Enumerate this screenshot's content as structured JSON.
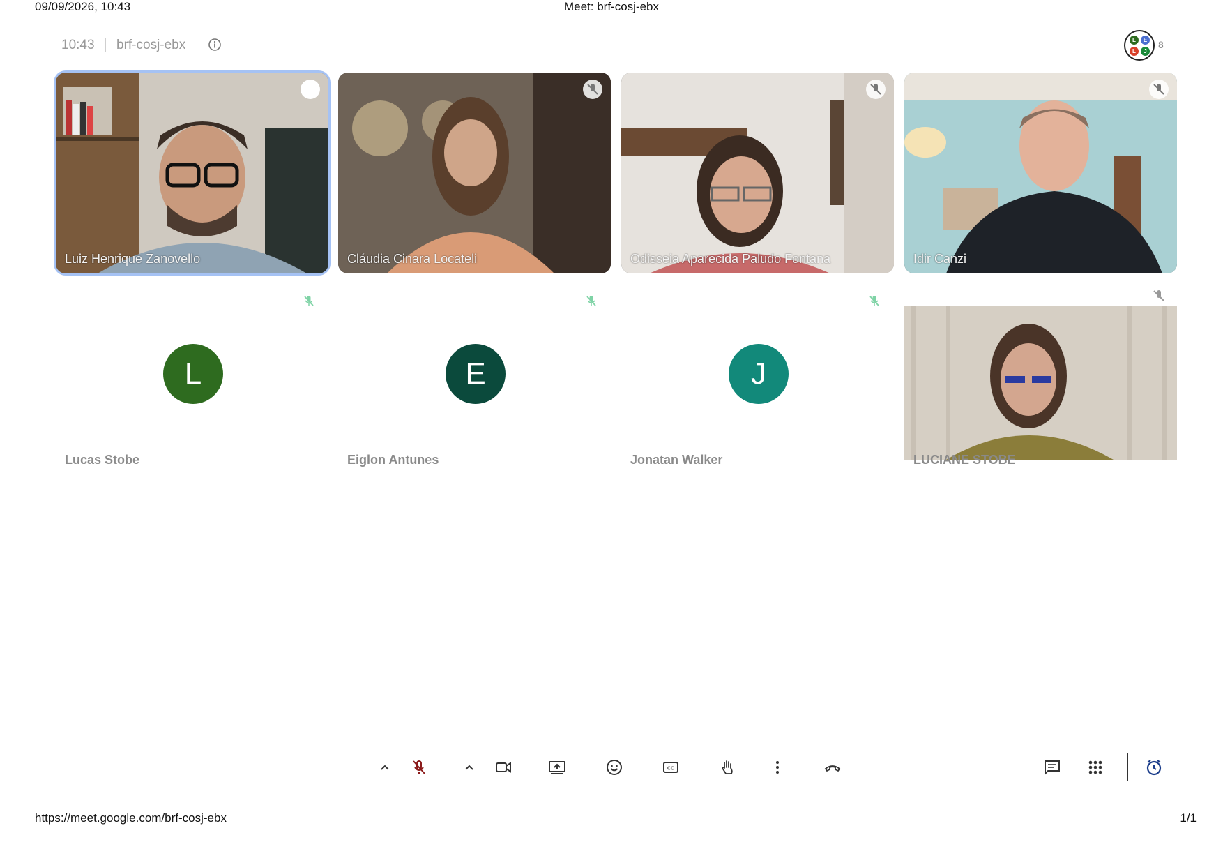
{
  "print": {
    "datetime": "09/09/2026, 10:43",
    "title": "Meet: brf-cosj-ebx",
    "url": "https://meet.google.com/brf-cosj-ebx",
    "page": "1/1"
  },
  "meeting": {
    "time": "10:43",
    "code": "brf-cosj-ebx",
    "participant_count": "8"
  },
  "people_avatars": [
    "L",
    "E",
    "L",
    "J"
  ],
  "participants": [
    {
      "name": "Luiz Henrique Zanovello",
      "type": "video",
      "active": true
    },
    {
      "name": "Cláudia Cinara Locateli",
      "type": "video"
    },
    {
      "name": "Odisseia Aparecida Paludo Fontana",
      "type": "video"
    },
    {
      "name": "Idir Canzi",
      "type": "video"
    },
    {
      "name": "Lucas Stobe",
      "type": "avatar",
      "initial": "L",
      "color": "#2e6b1f"
    },
    {
      "name": "Eiglon Antunes",
      "type": "avatar",
      "initial": "E",
      "color": "#0b4a3c"
    },
    {
      "name": "Jonatan Walker",
      "type": "avatar",
      "initial": "J",
      "color": "#12897a"
    },
    {
      "name": "LUCIANE STOBE",
      "type": "video"
    }
  ],
  "colors": {
    "mic_off_red": "#8b1a1a",
    "mic_muted_green": "#7fd3a6",
    "active_outline": "#a5c2f4"
  },
  "toolbar_icons": [
    "chevron-up-icon",
    "mic-off-icon",
    "chevron-up-icon",
    "camera-icon",
    "present-icon",
    "emoji-icon",
    "captions-icon",
    "raise-hand-icon",
    "more-options-icon",
    "leave-call-icon",
    "chat-icon",
    "activities-icon",
    "timer-icon"
  ]
}
